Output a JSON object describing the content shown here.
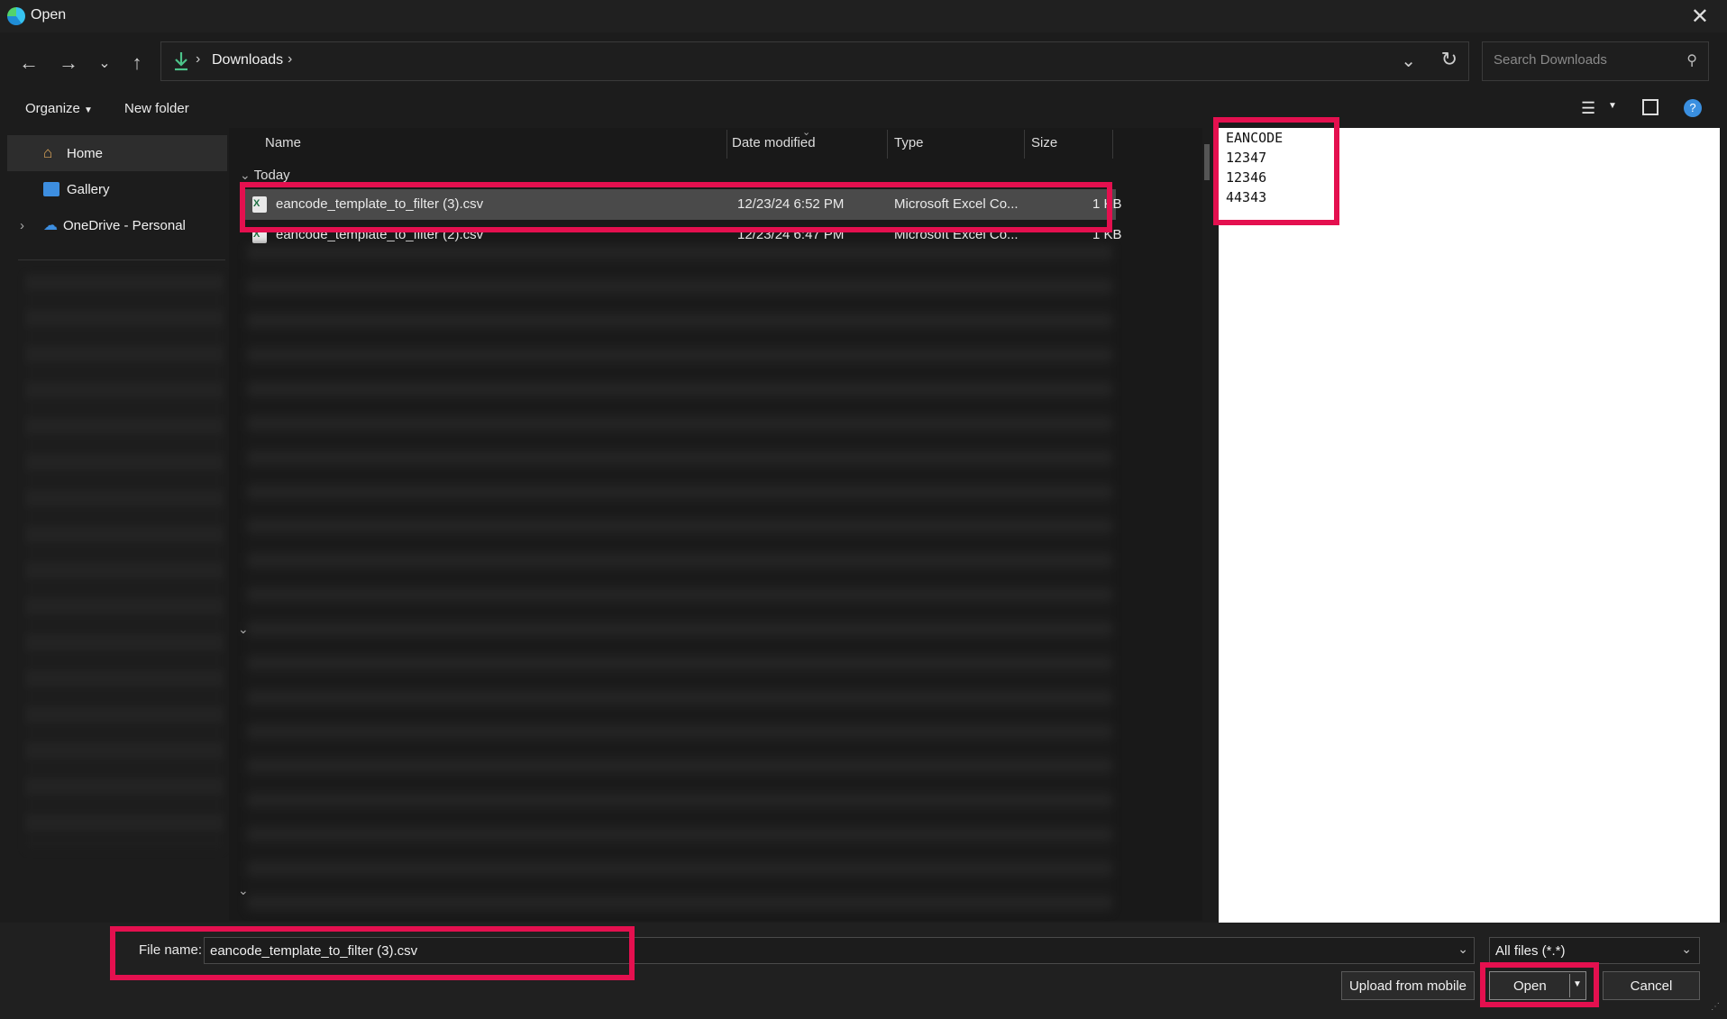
{
  "window": {
    "title": "Open"
  },
  "address": {
    "crumbs": [
      "Downloads"
    ]
  },
  "search": {
    "placeholder": "Search Downloads"
  },
  "toolbar": {
    "organize": "Organize",
    "new_folder": "New folder"
  },
  "sidebar": {
    "items": [
      {
        "label": "Home",
        "icon": "home-icon",
        "selected": true
      },
      {
        "label": "Gallery",
        "icon": "gallery-icon"
      },
      {
        "label": "OneDrive - Personal",
        "icon": "cloud-icon"
      }
    ]
  },
  "columns": {
    "name": "Name",
    "date": "Date modified",
    "type": "Type",
    "size": "Size"
  },
  "group": {
    "label": "Today"
  },
  "files": [
    {
      "name": "eancode_template_to_filter (3).csv",
      "date": "12/23/24 6:52 PM",
      "type": "Microsoft Excel Co...",
      "size": "1 KB",
      "selected": true
    },
    {
      "name": "eancode_template_to_filter (2).csv",
      "date": "12/23/24 6:47 PM",
      "type": "Microsoft Excel Co...",
      "size": "1 KB",
      "selected": false
    }
  ],
  "preview": {
    "content": "EANCODE\n12347\n12346\n44343"
  },
  "bottom": {
    "file_name_label": "File name:",
    "file_name_value": "eancode_template_to_filter (3).csv",
    "file_type": "All files (*.*)",
    "upload": "Upload from mobile",
    "open": "Open",
    "cancel": "Cancel"
  },
  "colors": {
    "highlight": "#e4104f",
    "background": "#1c1c1c",
    "preview_bg": "#ffffff"
  }
}
